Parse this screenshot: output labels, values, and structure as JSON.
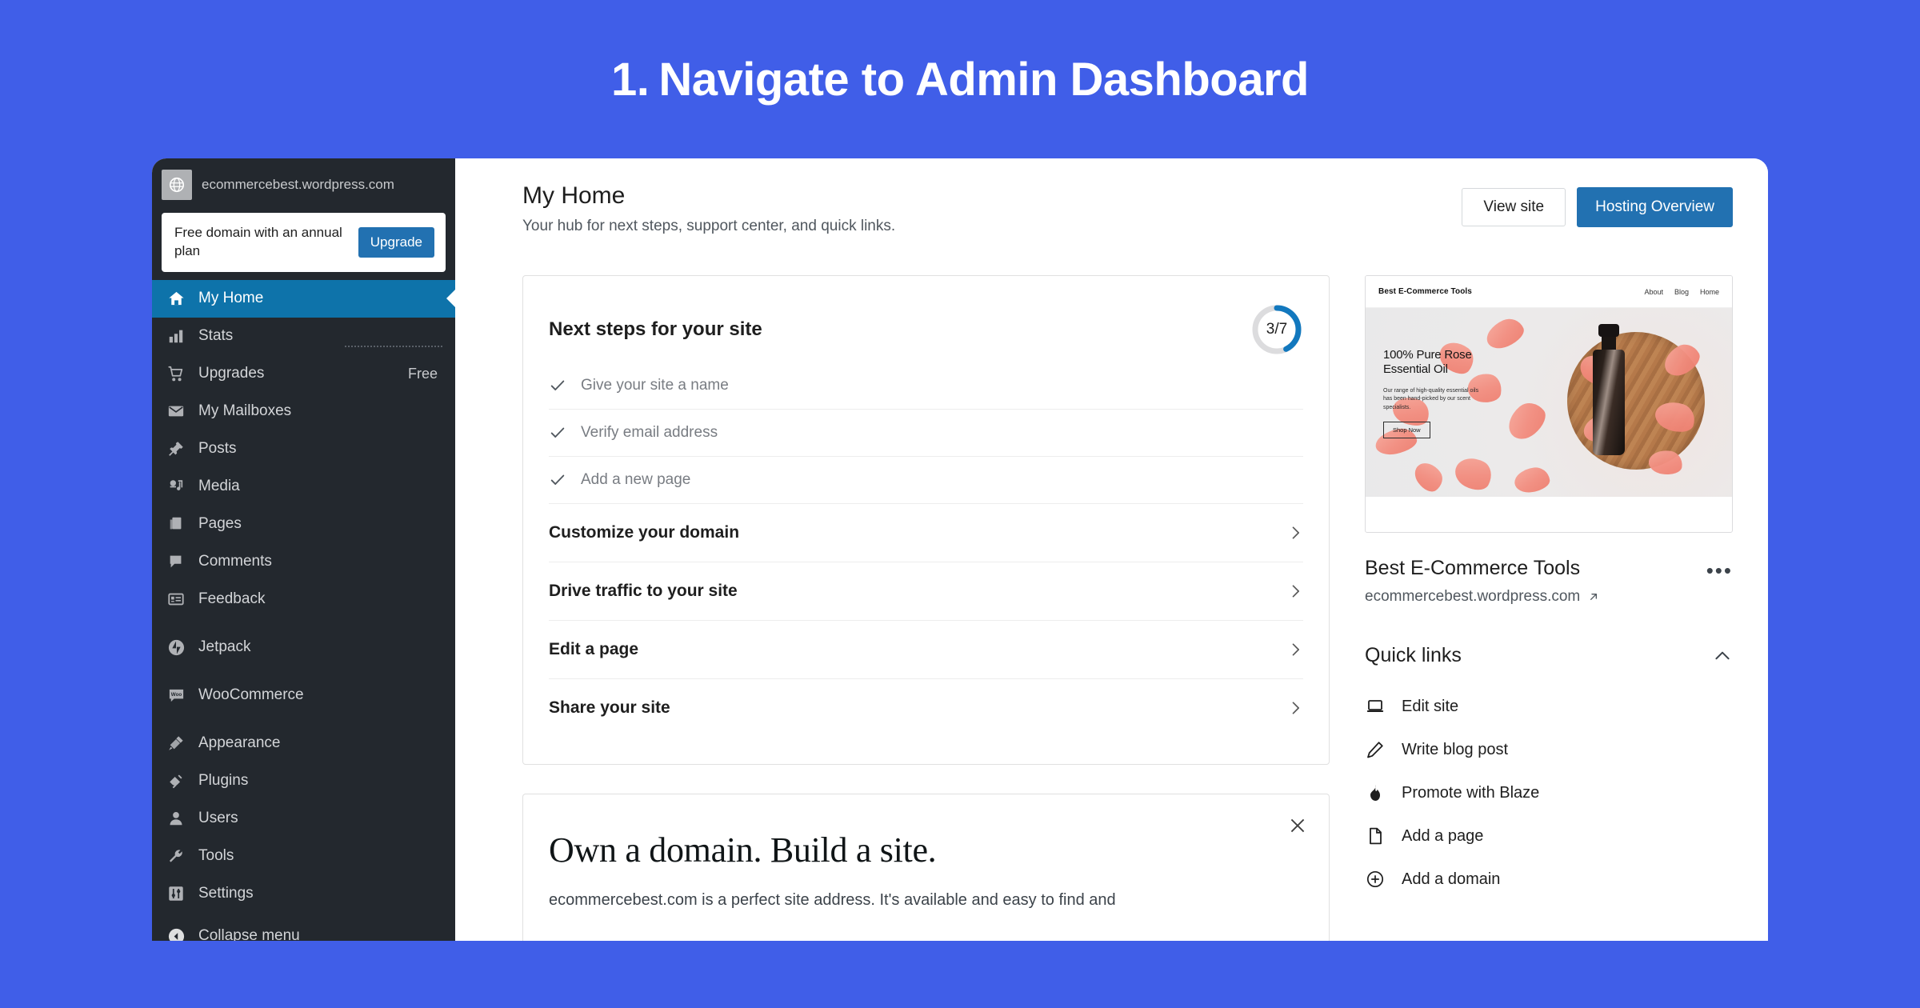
{
  "slide": {
    "number": "1.",
    "title": "Navigate to Admin Dashboard",
    "background_color": "#405EE8"
  },
  "sidebar": {
    "site_url": "ecommercebest.wordpress.com",
    "avatar_icon": "globe-icon",
    "upsell": {
      "text": "Free domain with an annual plan",
      "button_label": "Upgrade",
      "button_color": "#2271B1"
    },
    "active_color": "#0E73AA",
    "background_color": "#23282E",
    "items": [
      {
        "label": "My Home",
        "icon": "home-icon",
        "badge": "",
        "active": true,
        "gap_before": false
      },
      {
        "label": "Stats",
        "icon": "bar-chart-icon",
        "badge": "",
        "active": false,
        "gap_before": false
      },
      {
        "label": "Upgrades",
        "icon": "cart-icon",
        "badge": "Free",
        "active": false,
        "gap_before": false
      },
      {
        "label": "My Mailboxes",
        "icon": "envelope-icon",
        "badge": "",
        "active": false,
        "gap_before": false
      },
      {
        "label": "Posts",
        "icon": "pin-icon",
        "badge": "",
        "active": false,
        "gap_before": false
      },
      {
        "label": "Media",
        "icon": "media-icon",
        "badge": "",
        "active": false,
        "gap_before": false
      },
      {
        "label": "Pages",
        "icon": "pages-icon",
        "badge": "",
        "active": false,
        "gap_before": false
      },
      {
        "label": "Comments",
        "icon": "comment-icon",
        "badge": "",
        "active": false,
        "gap_before": false
      },
      {
        "label": "Feedback",
        "icon": "feedback-icon",
        "badge": "",
        "active": false,
        "gap_before": false
      },
      {
        "label": "Jetpack",
        "icon": "jetpack-icon",
        "badge": "",
        "active": false,
        "gap_before": true
      },
      {
        "label": "WooCommerce",
        "icon": "woocommerce-icon",
        "badge": "",
        "active": false,
        "gap_before": true
      },
      {
        "label": "Appearance",
        "icon": "brush-icon",
        "badge": "",
        "active": false,
        "gap_before": true
      },
      {
        "label": "Plugins",
        "icon": "plug-icon",
        "badge": "",
        "active": false,
        "gap_before": false
      },
      {
        "label": "Users",
        "icon": "user-icon",
        "badge": "",
        "active": false,
        "gap_before": false
      },
      {
        "label": "Tools",
        "icon": "wrench-icon",
        "badge": "",
        "active": false,
        "gap_before": false
      },
      {
        "label": "Settings",
        "icon": "sliders-icon",
        "badge": "",
        "active": false,
        "gap_before": false
      },
      {
        "label": "Collapse menu",
        "icon": "collapse-icon",
        "badge": "",
        "active": false,
        "gap_before": false
      }
    ]
  },
  "main": {
    "page_title": "My Home",
    "page_subtitle": "Your hub for next steps, support center, and quick links.",
    "view_site_label": "View site",
    "hosting_overview_label": "Hosting Overview",
    "next_steps": {
      "title": "Next steps for your site",
      "progress_label": "3/7",
      "progress_completed": 3,
      "progress_total": 7,
      "progress_color": "#1278BE",
      "completed_tasks": [
        "Give your site a name",
        "Verify email address",
        "Add a new page"
      ],
      "pending_tasks": [
        "Customize your domain",
        "Drive traffic to your site",
        "Edit a page",
        "Share your site"
      ]
    },
    "promo": {
      "title": "Own a domain. Build a site.",
      "body": "ecommercebest.com is a perfect site address. It's available and easy to find and",
      "close_icon": "close-icon"
    }
  },
  "right": {
    "preview": {
      "brand": "Best E-Commerce Tools",
      "nav": [
        "About",
        "Blog",
        "Home"
      ],
      "headline": "100% Pure Rose Essential Oil",
      "body": "Our range of high-quality essential oils has been hand-picked by our scent specialists.",
      "cta": "Shop Now"
    },
    "site_name": "Best E-Commerce Tools",
    "site_domain": "ecommercebest.wordpress.com",
    "external_link_icon": "external-link-icon",
    "more_menu_icon": "ellipsis-icon",
    "quick_links": {
      "title": "Quick links",
      "toggle_icon": "chevron-up-icon",
      "items": [
        {
          "label": "Edit site",
          "icon": "laptop-icon"
        },
        {
          "label": "Write blog post",
          "icon": "pencil-icon"
        },
        {
          "label": "Promote with Blaze",
          "icon": "flame-icon"
        },
        {
          "label": "Add a page",
          "icon": "page-icon"
        },
        {
          "label": "Add a domain",
          "icon": "plus-circle-icon"
        }
      ]
    }
  }
}
